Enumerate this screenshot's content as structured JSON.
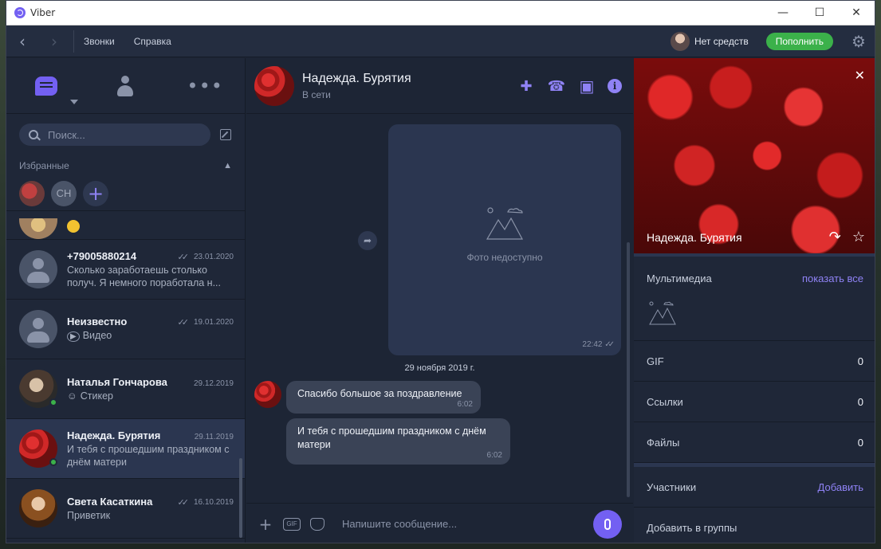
{
  "window": {
    "title": "Viber"
  },
  "topbar": {
    "links": [
      "Звонки",
      "Справка"
    ],
    "balance": "Нет средств",
    "topup_label": "Пополнить"
  },
  "search": {
    "placeholder": "Поиск..."
  },
  "favorites": {
    "title": "Избранные",
    "initials": "СН",
    "add": "+"
  },
  "chats": [
    {
      "name": "+79005880214",
      "date": "23.01.2020",
      "preview": "Сколько заработаешь столько получ. Я немного поработала н...",
      "read": true
    },
    {
      "name": "Неизвестно",
      "date": "19.01.2020",
      "preview": "Видео",
      "read": true
    },
    {
      "name": "Наталья Гончарова",
      "date": "29.12.2019",
      "preview": "Стикер",
      "read": false
    },
    {
      "name": "Надежда. Бурятия",
      "date": "29.11.2019",
      "preview": "И тебя с прошедшим праздником с днём матери",
      "read": false
    },
    {
      "name": "Света Касаткина",
      "date": "16.10.2019",
      "preview": "Приветик",
      "read": true
    }
  ],
  "chat": {
    "name": "Надежда. Бурятия",
    "status": "В сети",
    "photo_label": "Фото недоступно",
    "photo_time": "22:42",
    "date_separator": "29 ноября 2019 г.",
    "messages": [
      {
        "text": "Спасибо большое за поздравление",
        "time": "6:02"
      },
      {
        "text": "И тебя с прошедшим праздником с днём матери",
        "time": "6:02"
      }
    ],
    "composer_placeholder": "Напишите сообщение..."
  },
  "info": {
    "name": "Надежда. Бурятия",
    "media_title": "Мультимедиа",
    "media_link": "показать все",
    "rows": [
      {
        "label": "GIF",
        "value": "0"
      },
      {
        "label": "Ссылки",
        "value": "0"
      },
      {
        "label": "Файлы",
        "value": "0"
      }
    ],
    "members_label": "Участники",
    "members_action": "Добавить",
    "add_groups": "Добавить в группы"
  },
  "colors": {
    "accent": "#7360f2",
    "topup": "#3bb14a",
    "online": "#3bb14a"
  }
}
